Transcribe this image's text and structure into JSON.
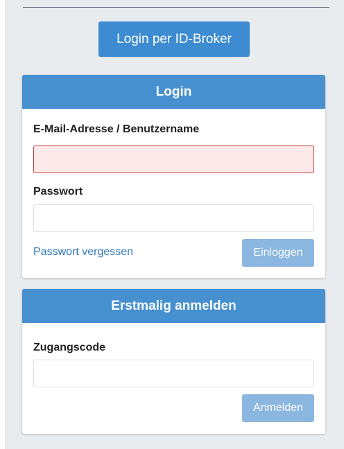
{
  "idbroker": {
    "label": "Login per ID-Broker"
  },
  "login": {
    "title": "Login",
    "email_label": "E-Mail-Adresse / Benutzername",
    "email_value": "",
    "password_label": "Passwort",
    "password_value": "",
    "forgot_link": "Passwort vergessen",
    "submit_label": "Einloggen"
  },
  "register": {
    "title": "Erstmalig anmelden",
    "code_label": "Zugangscode",
    "code_value": "",
    "submit_label": "Anmelden"
  },
  "colors": {
    "primary": "#4690d0",
    "button_disabled": "#8ab6e0",
    "link": "#2f7bbd",
    "error_bg": "#fde9e9",
    "error_border": "#c23a3a",
    "page_bg": "#e9ecef"
  }
}
